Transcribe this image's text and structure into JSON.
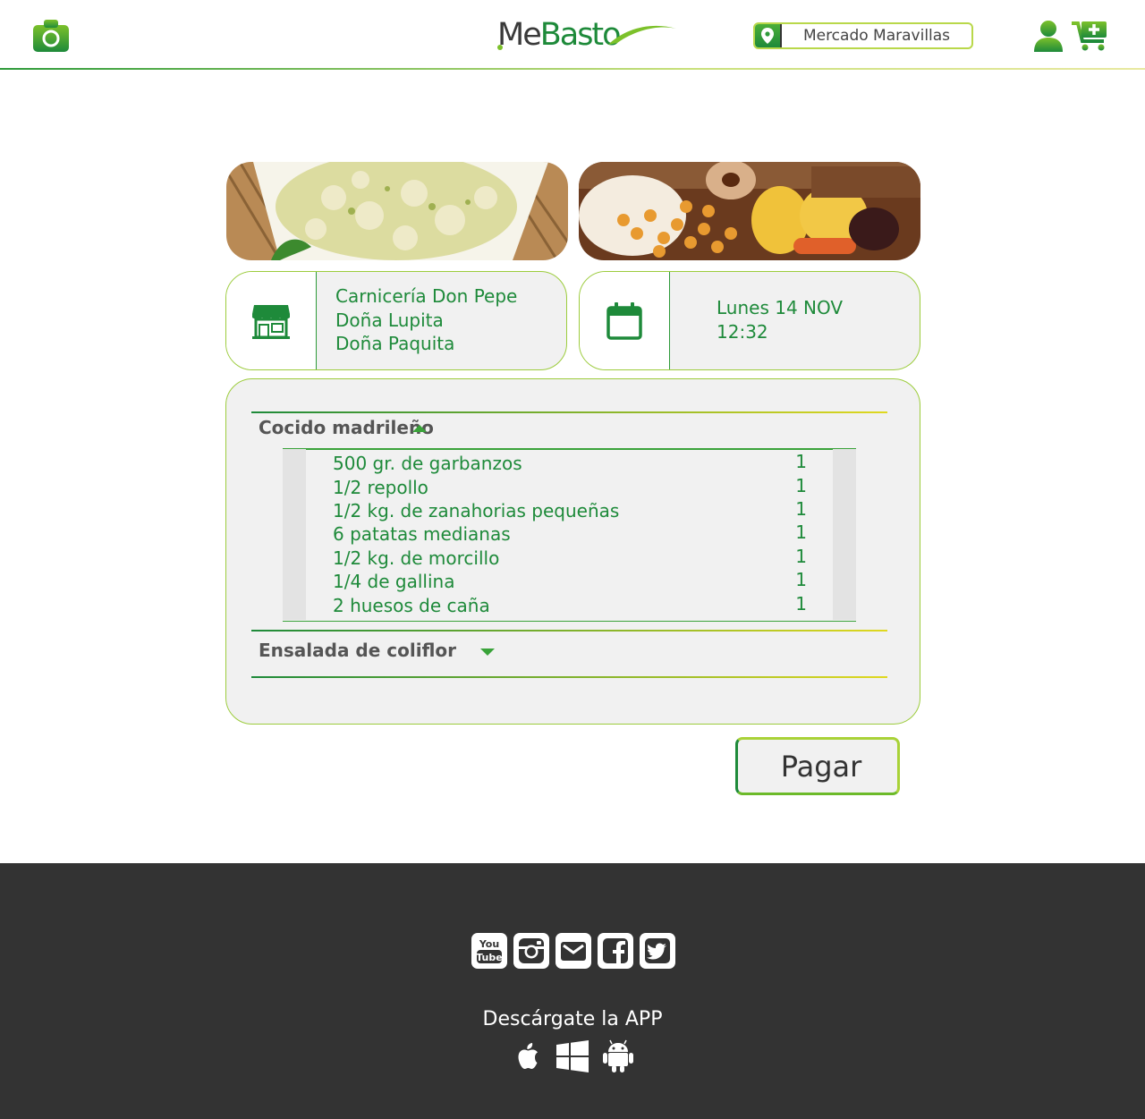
{
  "header": {
    "logo_me": "Me",
    "logo_basto": "Basto",
    "market_name": "Mercado Maravillas",
    "icons": [
      "camera-icon",
      "location-pin-icon",
      "user-icon",
      "cart-add-icon"
    ]
  },
  "info": {
    "shops": [
      "Carnicería Don Pepe",
      "Doña Lupita",
      "Doña Paquita"
    ],
    "date": "Lunes 14 NOV",
    "time": "12:32",
    "icons": [
      "store-icon",
      "calendar-icon"
    ]
  },
  "order": {
    "recipes": [
      {
        "name": "Cocido madrileño",
        "expanded": true,
        "ingredients": [
          {
            "name": "500 gr. de garbanzos",
            "qty": "1"
          },
          {
            "name": "1/2 repollo",
            "qty": "1"
          },
          {
            "name": "1/2 kg. de zanahorias pequeñas",
            "qty": "1"
          },
          {
            "name": "6 patatas medianas",
            "qty": "1"
          },
          {
            "name": "1/2 kg. de morcillo",
            "qty": "1"
          },
          {
            "name": "1/4 de gallina",
            "qty": "1"
          },
          {
            "name": "2 huesos de caña",
            "qty": "1"
          }
        ]
      },
      {
        "name": "Ensalada de coliflor",
        "expanded": false
      }
    ]
  },
  "pay_label": "Pagar",
  "footer": {
    "social": [
      "youtube-icon",
      "instagram-icon",
      "email-icon",
      "facebook-icon",
      "twitter-icon"
    ],
    "download_label": "Descárgate la APP",
    "stores": [
      "apple-icon",
      "windows-icon",
      "android-icon"
    ]
  },
  "colors": {
    "brand_green": "#1e8a3a",
    "accent_lime": "#a9d238",
    "panel_bg": "#f1f1f1",
    "footer_bg": "#333333"
  }
}
